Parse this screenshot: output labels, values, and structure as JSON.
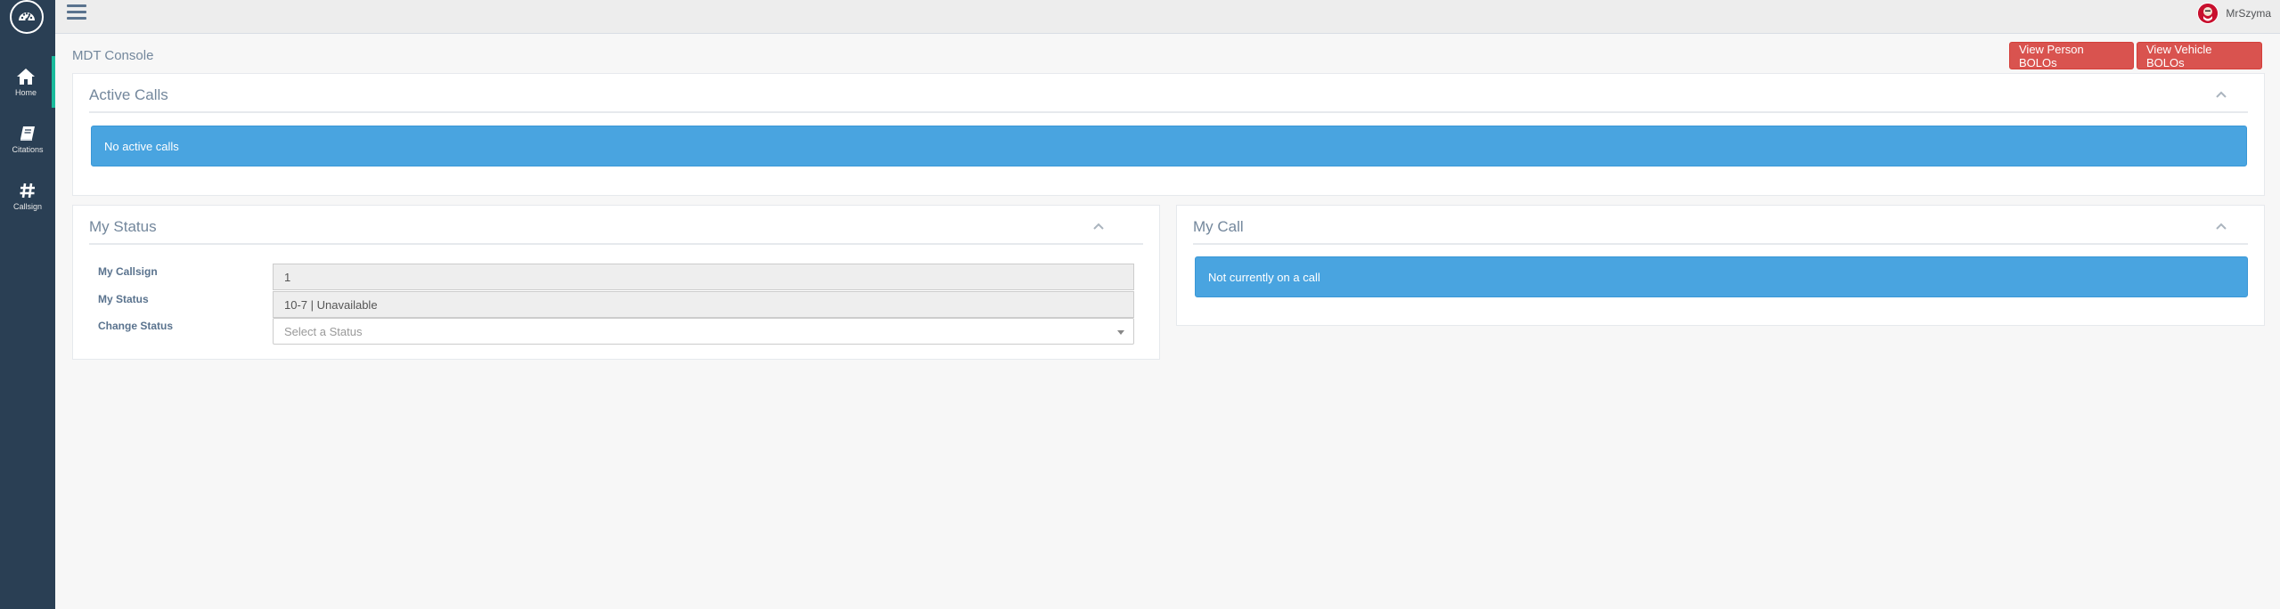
{
  "sidebar": {
    "brand_icon": "dashboard-gauge-icon",
    "items": [
      {
        "label": "Home",
        "icon": "home-icon",
        "active": true
      },
      {
        "label": "Citations",
        "icon": "book-icon",
        "active": false
      },
      {
        "label": "Callsign",
        "icon": "hash-icon",
        "active": false
      }
    ]
  },
  "topnav": {
    "menu_icon": "hamburger-menu-icon",
    "user_name": "MrSzyma"
  },
  "page": {
    "title": "MDT Console",
    "buttons": {
      "person_bolos": "View Person BOLOs",
      "vehicle_bolos": "View Vehicle BOLOs"
    }
  },
  "active_calls": {
    "title": "Active Calls",
    "message": "No active calls"
  },
  "my_status": {
    "title": "My Status",
    "callsign_label": "My Callsign",
    "callsign_value": "1",
    "status_label": "My Status",
    "status_value": "10-7 | Unavailable",
    "change_label": "Change Status",
    "change_placeholder": "Select a Status"
  },
  "my_call": {
    "title": "My Call",
    "message": "Not currently on a call"
  },
  "colors": {
    "sidebar": "#2a3f54",
    "accent": "#1abb9c",
    "danger": "#d9534f",
    "info": "#49a4e0"
  }
}
